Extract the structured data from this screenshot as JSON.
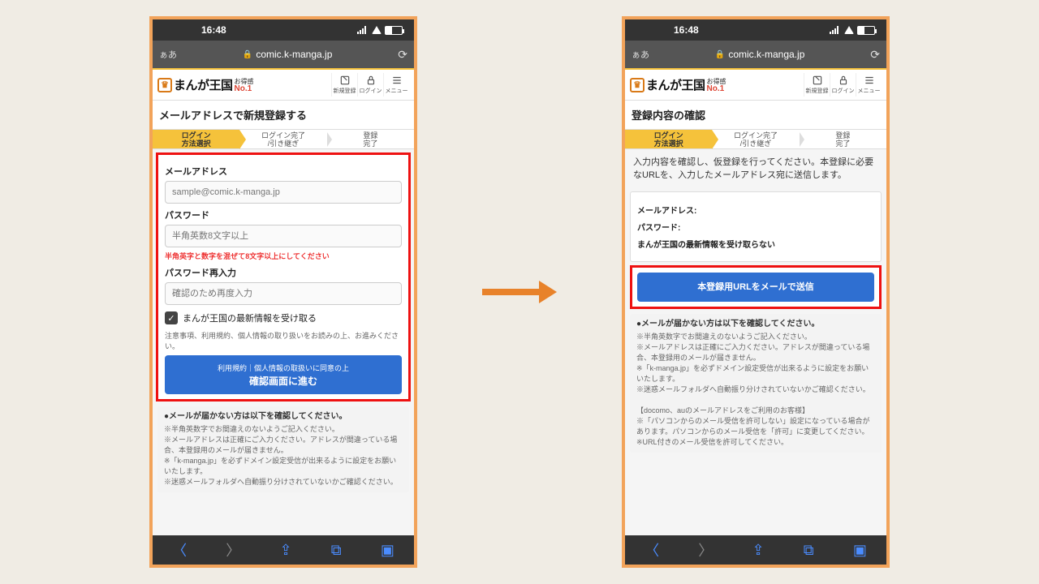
{
  "status": {
    "time": "16:48"
  },
  "address": {
    "aa": "ぁあ",
    "url": "comic.k-manga.jp"
  },
  "brand": {
    "name": "まんが王国",
    "badge_top": "お得感",
    "badge_bottom": "No.1"
  },
  "header_buttons": {
    "register": "新規登録",
    "login": "ログイン",
    "menu": "メニュー"
  },
  "steps": {
    "s1": "ログイン\n方法選択",
    "s2": "ログイン完了\n/引き継ぎ",
    "s3": "登録\n完了"
  },
  "left": {
    "title": "メールアドレスで新規登録する",
    "label_email": "メールアドレス",
    "ph_email": "sample@comic.k-manga.jp",
    "label_pw": "パスワード",
    "ph_pw": "半角英数8文字以上",
    "hint_pw": "半角英字と数字を混ぜて8文字以上にしてください",
    "label_pw2": "パスワード再入力",
    "ph_pw2": "確認のため再度入力",
    "chk_label": "まんが王国の最新情報を受け取る",
    "note1": "注意事項、利用規約、個人情報の取り扱いをお読みの上、お進みください。",
    "btn_sub": "利用規約｜個人情報の取扱いに同意の上",
    "btn_main": "確認画面に進む"
  },
  "right": {
    "title": "登録内容の確認",
    "desc": "入力内容を確認し、仮登録を行ってください。本登録に必要なURLを、入力したメールアドレス宛に送信します。",
    "row_email": "メールアドレス:",
    "row_pw": "パスワード:",
    "row_optout": "まんが王国の最新情報を受け取らない",
    "btn": "本登録用URLをメールで送信"
  },
  "info": {
    "hd": "●メールが届かない方は以下を確認してください。",
    "l1": "※半角英数字でお間違えのないようご記入ください。",
    "l2": "※メールアドレスは正確にご入力ください。アドレスが間違っている場合、本登録用のメールが届きません。",
    "l3": "※「k-manga.jp」を必ずドメイン設定受信が出来るように設定をお願いいたします。",
    "l4": "※迷惑メールフォルダへ自動振り分けされていないかご確認ください。",
    "l5": "【docomo、auのメールアドレスをご利用のお客様】",
    "l6": "※「パソコンからのメール受信を許可しない」設定になっている場合があります。パソコンからのメール受信を「許可」に変更してください。",
    "l7": "※URL付きのメール受信を許可してください。"
  }
}
